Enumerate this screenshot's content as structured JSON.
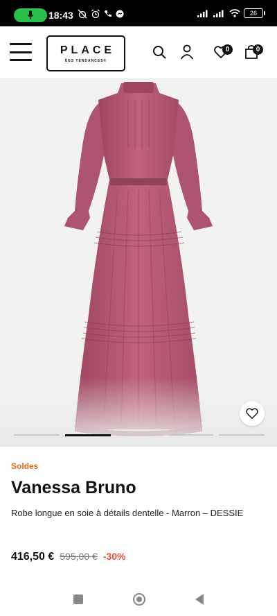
{
  "status_bar": {
    "time": "18:43",
    "battery": "26",
    "icons": [
      "mic-icon",
      "alarm-off-icon",
      "alarm-icon",
      "call-icon",
      "messenger-icon",
      "signal-icon",
      "signal-icon",
      "wifi-icon",
      "battery-icon"
    ]
  },
  "header": {
    "logo_main": "PLACE",
    "logo_sub": "DES TENDANCES®",
    "wishlist_count": "0",
    "cart_count": "0",
    "icons": [
      "menu-icon",
      "search-icon",
      "account-icon",
      "heart-icon",
      "bag-icon"
    ]
  },
  "gallery": {
    "image_count": 5,
    "active_index": 1,
    "dress_color": "#b5566f"
  },
  "product": {
    "sale_tag": "Soldes",
    "brand": "Vanessa Bruno",
    "description": "Robe longue en soie à détails dentelle - Marron – DESSIE",
    "price_now": "416,50 €",
    "price_old": "595,00 €",
    "discount": "-30%"
  },
  "colors": {
    "sale": "#e86a1a",
    "discount": "#e8503a",
    "mic_pill": "#27c04a"
  }
}
